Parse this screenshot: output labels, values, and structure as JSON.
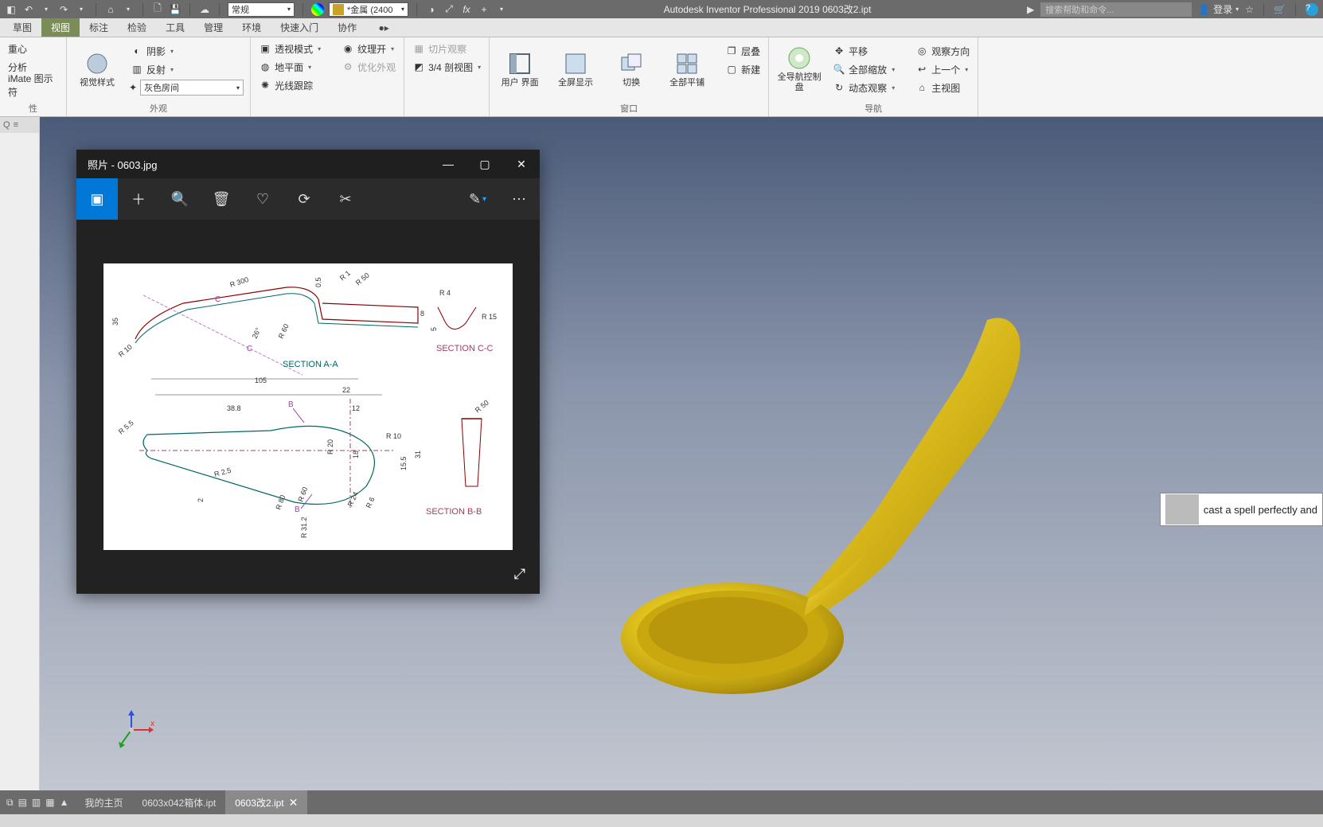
{
  "app": {
    "title": "Autodesk Inventor Professional 2019   0603改2.ipt",
    "search_placeholder": "搜索帮助和命令...",
    "login": "登录"
  },
  "qat": {
    "style_combo": "常规",
    "material_combo": "*金属 (2400"
  },
  "tabs": [
    "草图",
    "视图",
    "标注",
    "检验",
    "工具",
    "管理",
    "环境",
    "快速入门",
    "协作"
  ],
  "active_tab_index": 1,
  "left_panel": {
    "items": [
      "重心",
      "分析",
      "iMate 图示符",
      "性"
    ]
  },
  "ribbon": {
    "group1": {
      "big": "视觉样式",
      "rows": [
        "阴影",
        "反射",
        "灰色房间"
      ],
      "rows_icons": [
        "shadow",
        "reflect",
        "room"
      ],
      "label": "外观"
    },
    "group2": {
      "rows": [
        "透视模式",
        "地平面",
        "光线跟踪",
        "纹理开",
        "优化外观"
      ],
      "rows_icons": [
        "perspective",
        "groundplane",
        "raytrace",
        "texture",
        "optimize"
      ]
    },
    "group3": {
      "rows": [
        "切片观察",
        "3/4 剖视图"
      ],
      "rows_icons": [
        "slice",
        "threequarter"
      ]
    },
    "group4": {
      "big": [
        "用户\n界面",
        "全屏显示",
        "切换",
        "全部平铺"
      ],
      "rows": [
        "层叠",
        "新建"
      ],
      "label": "窗口"
    },
    "group5": {
      "big": "全导航控制盘",
      "rows": [
        "平移",
        "全部缩放",
        "动态观察",
        "观察方向",
        "上一个",
        "主视图"
      ],
      "label": "导航"
    }
  },
  "bottom": {
    "tabs": [
      "我的主页",
      "0603x042箱体.ipt",
      "0603改2.ipt"
    ],
    "active_tab_index": 2
  },
  "photos": {
    "title": "照片 - 0603.jpg",
    "drawing": {
      "sectionAA": "SECTION  A-A",
      "sectionBB": "SECTION  B-B",
      "sectionCC": "SECTION  C-C",
      "labels": {
        "R300": "R 300",
        "R35": "35",
        "R10a": "R 10",
        "d26": "26°",
        "R60": "R 60",
        "d05": "0.5",
        "R1": "R 1",
        "R50": "R 50",
        "d8": "8",
        "R4": "R 4",
        "R15": "R 15",
        "d5": "5",
        "d105": "105",
        "d22": "22",
        "d12": "12",
        "d388": "38.8",
        "B1": "B",
        "B2": "B",
        "C1": "C",
        "C2": "C",
        "R55": "R 5.5",
        "R25": "R 2.5",
        "R20": "R 20",
        "d18": "18",
        "R10b": "R 10",
        "d155": "15.5",
        "d31": "31",
        "R60b": "R 60",
        "R80": "R 80",
        "R24": "R 24",
        "R6": "R 6",
        "R312": "R 31.2",
        "d2": "2",
        "R50b": "R 50"
      }
    }
  },
  "tooltip": {
    "text": "cast a spell perfectly and"
  }
}
